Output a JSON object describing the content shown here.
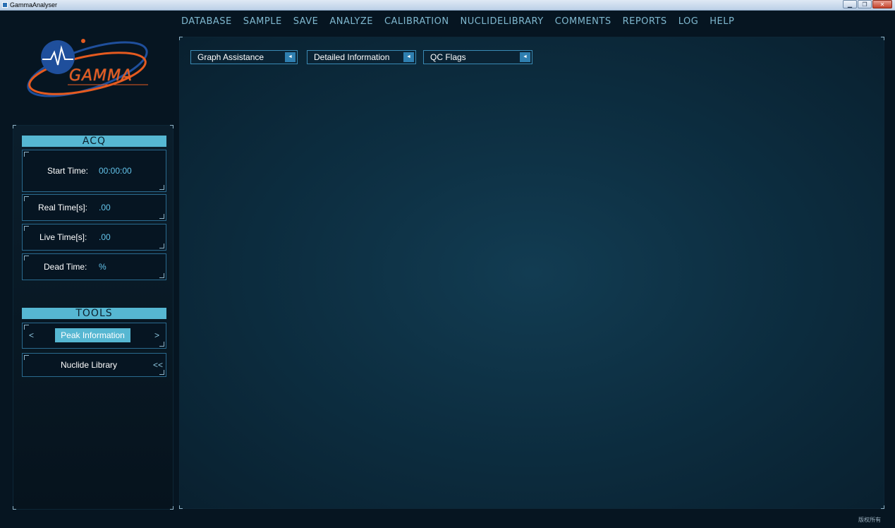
{
  "window": {
    "title": "GammaAnalyser",
    "blurred_title": "",
    "blurred_center": "",
    "buttons": {
      "minimize": "▁",
      "maximize": "❐",
      "close": "✕"
    }
  },
  "menu": [
    "DATABASE",
    "SAMPLE",
    "SAVE",
    "ANALYZE",
    "CALIBRATION",
    "NUCLIDELIBRARY",
    "COMMENTS",
    "REPORTS",
    "LOG",
    "HELP"
  ],
  "logo": {
    "text": "GAMMA",
    "icon": "heartbeat-orbit-logo"
  },
  "acq": {
    "header": "ACQ",
    "start_time": {
      "label": "Start Time:",
      "value": "00:00:00"
    },
    "real_time": {
      "label": "Real Time[s]:",
      "value": ".00"
    },
    "live_time": {
      "label": "Live Time[s]:",
      "value": ".00"
    },
    "dead_time": {
      "label": "Dead Time:",
      "value": "%"
    }
  },
  "tools": {
    "header": "TOOLS",
    "peak_info": {
      "prev": "<",
      "label": "Peak Information",
      "next": ">"
    },
    "nuclide_library": {
      "label": "Nuclide Library",
      "expand": "<<"
    }
  },
  "main": {
    "dropdowns": [
      {
        "label": "Graph Assistance",
        "arrow": "◄"
      },
      {
        "label": "Detailed Information",
        "arrow": "◄"
      },
      {
        "label": "QC Flags",
        "arrow": "◄"
      }
    ]
  },
  "footer": {
    "text": "版权所有"
  },
  "colors": {
    "background": "#061521",
    "menu_text": "#7fb8cf",
    "accent": "#56b7d2",
    "value_text": "#63c3ea",
    "logo_orange": "#e55a1f",
    "logo_blue": "#1f4f9c"
  }
}
